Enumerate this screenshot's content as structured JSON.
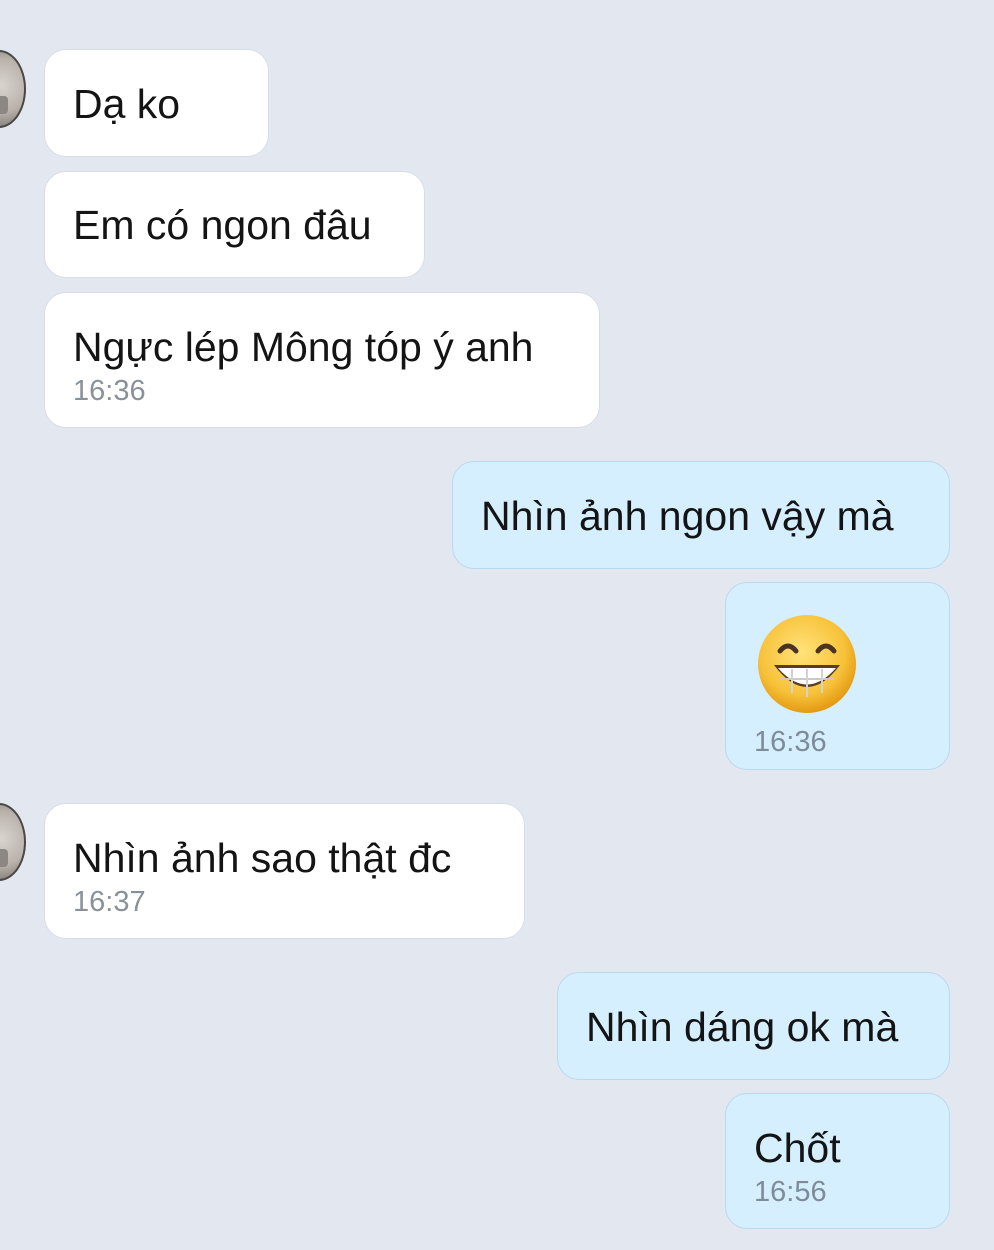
{
  "messages": [
    {
      "side": "in",
      "text": "Dạ ko"
    },
    {
      "side": "in",
      "text": "Em có ngon đâu"
    },
    {
      "side": "in",
      "text": "Ngực lép Mông tóp ý anh",
      "time": "16:36"
    },
    {
      "side": "out",
      "text": "Nhìn ảnh ngon vậy mà"
    },
    {
      "side": "out",
      "emoji": "grinning-face-with-smiling-eyes",
      "time": "16:36"
    },
    {
      "side": "in",
      "text": "Nhìn ảnh sao thật đc",
      "time": "16:37"
    },
    {
      "side": "out",
      "text": "Nhìn dáng ok mà"
    },
    {
      "side": "out",
      "text": "Chốt",
      "time": "16:56"
    }
  ],
  "colors": {
    "background": "#e3e8f0",
    "incoming_bubble": "#ffffff",
    "outgoing_bubble": "#d5efff",
    "timestamp": "#8a9199",
    "emoji_face": "#f7c23a"
  },
  "icons": {
    "avatar": "contact-avatar",
    "emoji": "grinning-face-with-smiling-eyes"
  }
}
